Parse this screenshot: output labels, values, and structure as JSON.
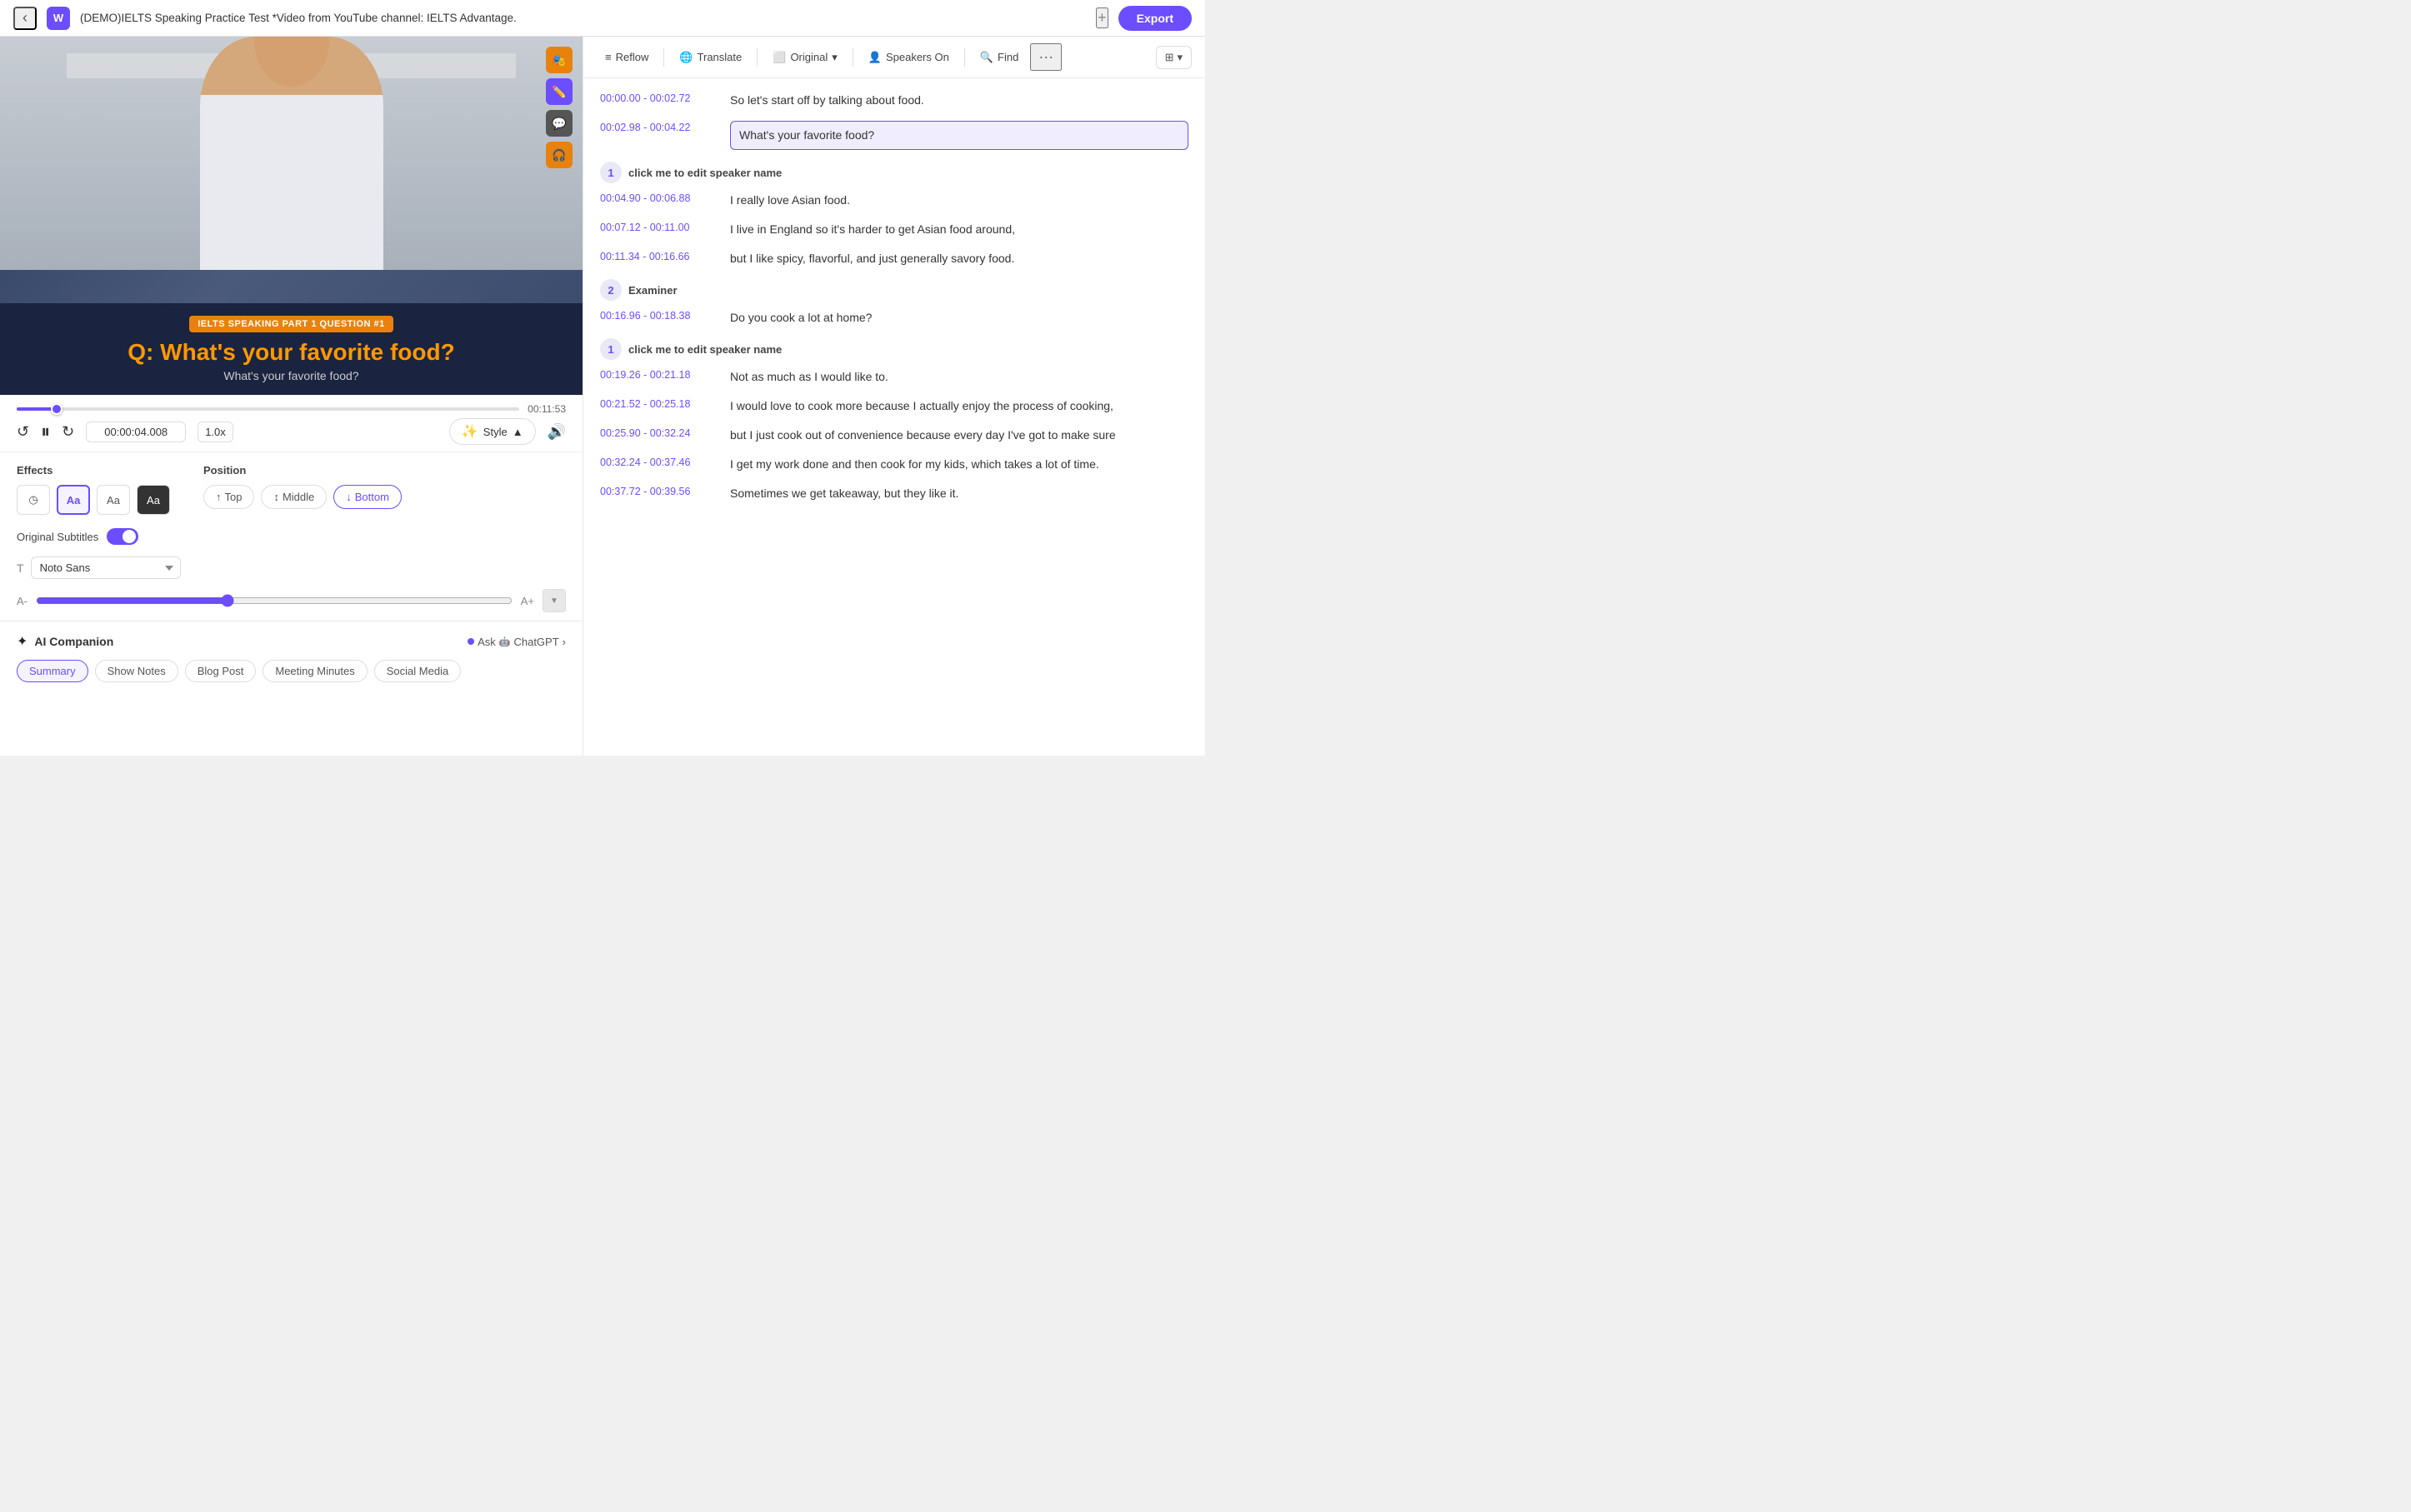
{
  "topbar": {
    "back_label": "‹",
    "logo_label": "W",
    "title": "(DEMO)IELTS Speaking Practice Test *Video from YouTube channel: IELTS Advantage.",
    "plus_label": "+",
    "export_label": "Export"
  },
  "toolbar": {
    "reflow_label": "Reflow",
    "translate_label": "Translate",
    "original_label": "Original",
    "speakers_on_label": "Speakers On",
    "find_label": "Find",
    "more_label": "···",
    "layout_label": "⊞"
  },
  "video": {
    "badge": "IELTS SPEAKING PART 1 QUESTION #1",
    "question": "What's your favorite food?",
    "subtitle": "What's your favorite food?",
    "duration": "00:11:53",
    "timecode": "00:00:04.008",
    "speed": "1.0x"
  },
  "effects": {
    "label": "Effects",
    "position_label": "Position",
    "buttons": [
      {
        "id": "clock",
        "symbol": "◷"
      },
      {
        "id": "aa-outline",
        "symbol": "Aa"
      },
      {
        "id": "aa-plain",
        "symbol": "Aa"
      },
      {
        "id": "aa-dark",
        "symbol": "Aa"
      }
    ],
    "positions": [
      {
        "id": "top",
        "label": "Top",
        "symbol": "↑"
      },
      {
        "id": "middle",
        "label": "Middle",
        "symbol": "↕"
      },
      {
        "id": "bottom",
        "label": "Bottom",
        "symbol": "↓"
      }
    ]
  },
  "original_subtitles": {
    "label": "Original Subtitles",
    "font_label": "Noto Sans"
  },
  "ai_companion": {
    "title": "AI Companion",
    "ask_label": "Ask",
    "chatgpt_label": "ChatGPT",
    "arrow": "›",
    "tabs": [
      {
        "id": "summary",
        "label": "Summary",
        "active": true
      },
      {
        "id": "show-notes",
        "label": "Show Notes"
      },
      {
        "id": "blog-post",
        "label": "Blog Post"
      },
      {
        "id": "meeting-minutes",
        "label": "Meeting Minutes"
      },
      {
        "id": "social-media",
        "label": "Social Media"
      }
    ]
  },
  "transcript": {
    "highlighted_time": "00:02.98  -  00:04.22",
    "highlighted_text": "What's your favorite food?",
    "entries": [
      {
        "time": "00:00.00  -  00:02.72",
        "text": "So let's start off by talking about food.",
        "speaker": null
      },
      {
        "time": "00:02.98  -  00:04.22",
        "text": "What's your favorite food?",
        "highlighted": true,
        "speaker": null
      },
      {
        "speaker_num": "1",
        "speaker_name": "click me to edit speaker name"
      },
      {
        "time": "00:04.90  -  00:06.88",
        "text": "I really love Asian food.",
        "speaker": null
      },
      {
        "time": "00:07.12  -  00:11.00",
        "text": "I live in England so it's harder to get Asian food around,",
        "speaker": null
      },
      {
        "time": "00:11.34  -  00:16.66",
        "text": "but I like spicy, flavorful, and just generally savory food.",
        "speaker": null
      },
      {
        "speaker_num": "2",
        "speaker_name": "Examiner"
      },
      {
        "time": "00:16.96  -  00:18.38",
        "text": "Do you cook a lot at home?",
        "speaker": null
      },
      {
        "speaker_num": "1",
        "speaker_name": "click me to edit speaker name"
      },
      {
        "time": "00:19.26  -  00:21.18",
        "text": "Not as much as I would like to.",
        "speaker": null
      },
      {
        "time": "00:21.52  -  00:25.18",
        "text": "I would love to cook more because I actually enjoy the process of cooking,",
        "speaker": null
      },
      {
        "time": "00:25.90  -  00:32.24",
        "text": "but I just cook out of convenience because every day I've got to make sure",
        "speaker": null
      },
      {
        "time": "00:32.24  -  00:37.46",
        "text": "I get my work done and then cook for my kids, which takes a lot of time.",
        "speaker": null
      },
      {
        "time": "00:37.72  -  00:39.56",
        "text": "Sometimes we get takeaway, but they like it.",
        "speaker": null
      }
    ]
  }
}
